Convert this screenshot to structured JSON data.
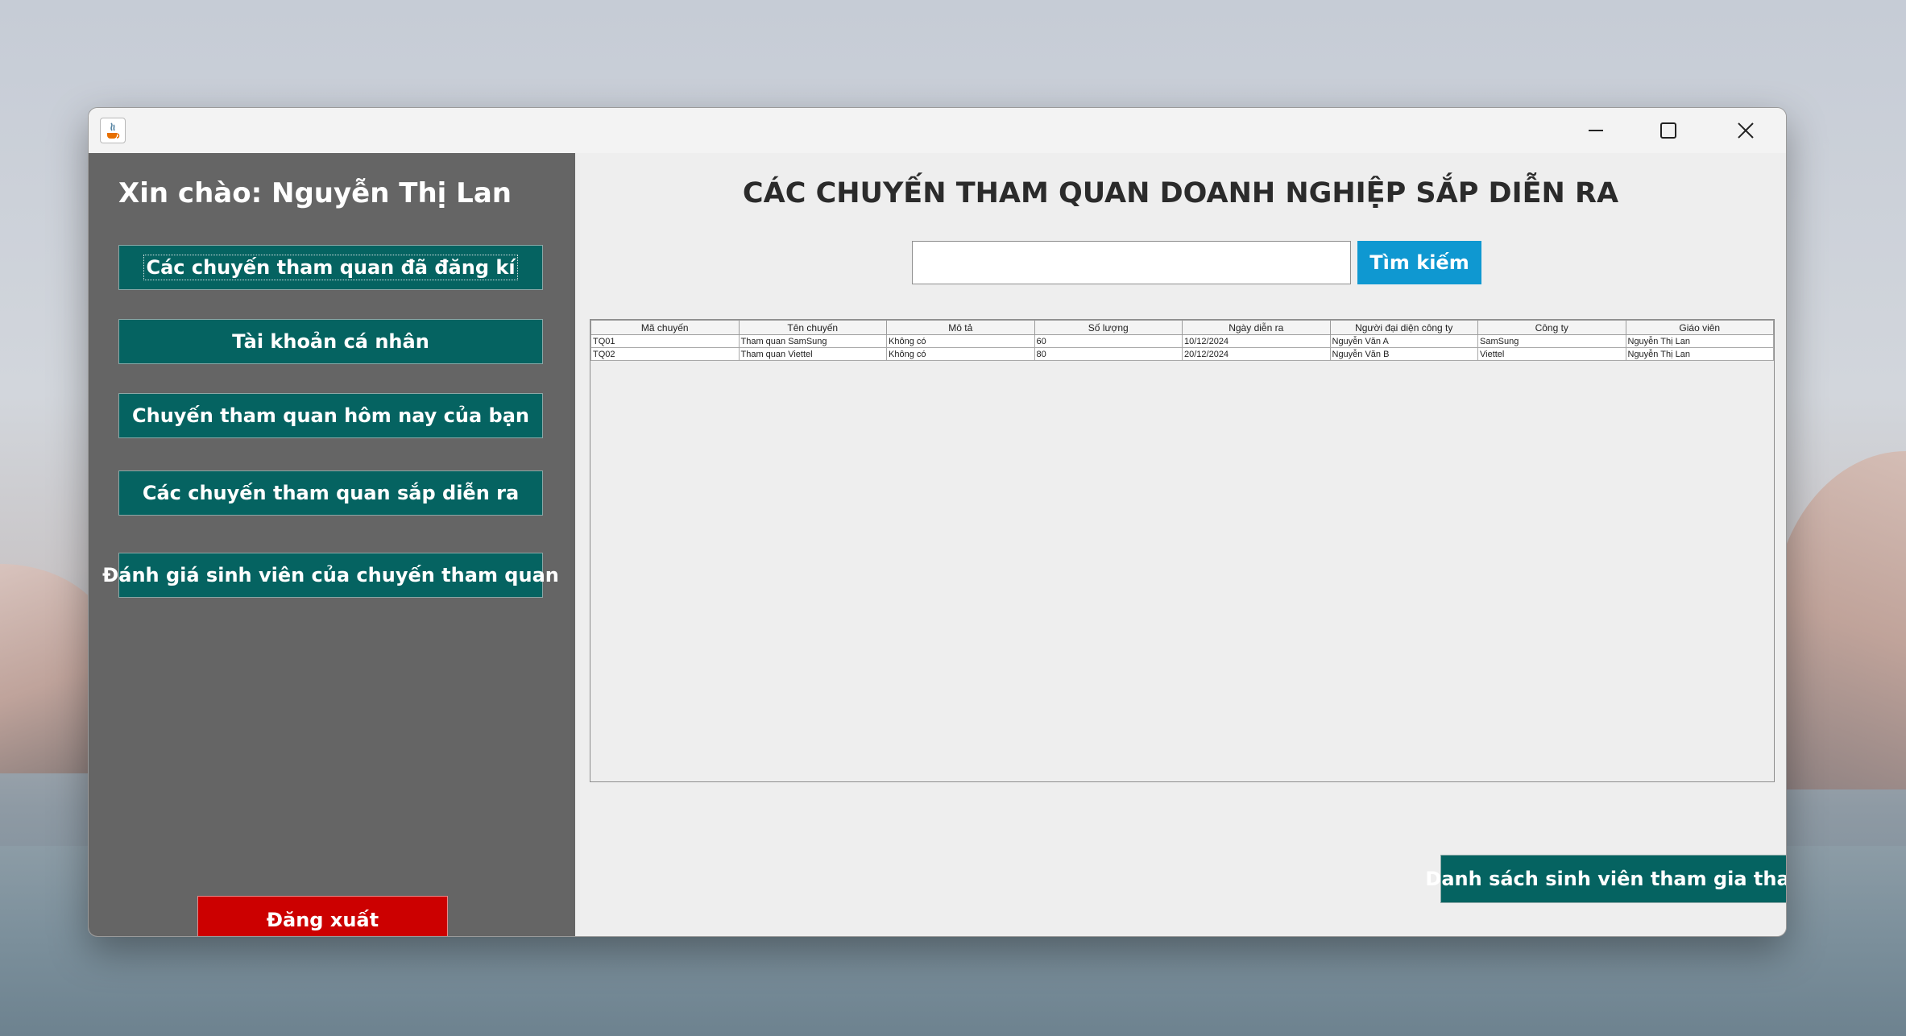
{
  "window": {
    "title": "",
    "colors": {
      "sidebar": "#656565",
      "nav_button": "#056361",
      "logout": "#cc0000",
      "search_button": "#0f98d1"
    }
  },
  "sidebar": {
    "greeting": "Xin chào: Nguyễn Thị Lan",
    "items": [
      {
        "label": "Các chuyến tham quan đã đăng kí"
      },
      {
        "label": "Tài khoản cá nhân"
      },
      {
        "label": "Chuyến tham quan hôm nay của bạn"
      },
      {
        "label": "Các chuyến tham quan sắp diễn ra"
      },
      {
        "label": "Đánh giá sinh viên của chuyến tham quan"
      }
    ],
    "logout_label": "Đăng xuất"
  },
  "main": {
    "title": "CÁC CHUYẾN THAM QUAN DOANH NGHIỆP SẮP DIỄN RA",
    "search": {
      "value": "",
      "placeholder": "",
      "button_label": "Tìm kiếm"
    },
    "table": {
      "columns": [
        "Mã chuyến",
        "Tên chuyến",
        "Mô tả",
        "Số lượng",
        "Ngày  diễn ra",
        "Người đại diện công ty",
        "Công ty",
        "Giáo viên"
      ],
      "rows": [
        [
          "TQ01",
          "Tham quan SamSung",
          "Không có",
          "60",
          "10/12/2024",
          "Nguyễn Văn A",
          "SamSung",
          "Nguyễn Thị Lan"
        ],
        [
          "TQ02",
          "Tham quan Viettel",
          "Không có",
          "80",
          "20/12/2024",
          "Nguyễn Văn B",
          "Viettel",
          "Nguyễn Thị Lan"
        ]
      ]
    },
    "students_button_label": "Danh sách sinh viên tham gia tham quan"
  }
}
